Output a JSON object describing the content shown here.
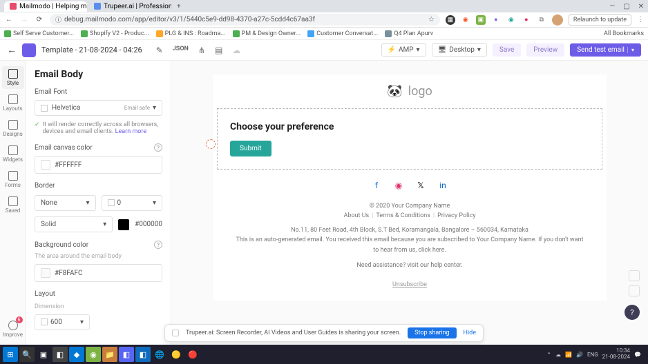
{
  "browser": {
    "tabs": [
      {
        "title": "Mailmodo | Helping marketer..."
      },
      {
        "title": "Trupeer.ai | Professional Vide..."
      }
    ],
    "url": "debug.mailmodo.com/app/editor/v3/1/5440c5e9-dd98-4370-a27c-5cdd4c67aa3f",
    "relaunch": "Relaunch to update",
    "all_bookmarks": "All Bookmarks",
    "bookmarks": [
      "Self Serve Customer...",
      "Shopify V2 - Produc...",
      "PLG & INS : Roadma...",
      "PM & Design Owner...",
      "Customer Conversat...",
      "Q4 Plan Apurv"
    ]
  },
  "header": {
    "title": "Template - 21-08-2024 - 04:26",
    "amp": "AMP",
    "desktop": "Desktop",
    "save": "Save",
    "preview": "Preview",
    "send": "Send test email"
  },
  "leftnav": [
    {
      "label": "Style"
    },
    {
      "label": "Layouts"
    },
    {
      "label": "Designs"
    },
    {
      "label": "Widgets"
    },
    {
      "label": "Forms"
    },
    {
      "label": "Saved"
    },
    {
      "label": "Improve",
      "badge": "6"
    }
  ],
  "sidebar": {
    "title": "Email Body",
    "font_label": "Email Font",
    "font_value": "Helvetica",
    "font_badge": "Email safe",
    "hint_text": "It will render correctly across all browsers, devices and email clients.",
    "hint_link": "Learn more",
    "canvas_color_label": "Email canvas color",
    "canvas_color_value": "#FFFFFF",
    "border_label": "Border",
    "border_style": "None",
    "border_width": "0",
    "border_line": "Solid",
    "border_color": "#000000",
    "bg_label": "Background color",
    "bg_sublabel": "The area around the email body",
    "bg_value": "#F8FAFC",
    "layout_label": "Layout",
    "dimension_label": "Dimension",
    "dimension_value": "600"
  },
  "email": {
    "logo_text": "logo",
    "preference_title": "Choose your preference",
    "submit": "Submit",
    "copyright": "© 2020 Your Company Name",
    "links": [
      "About Us",
      "Terms & Conditions",
      "Privacy Policy"
    ],
    "address": "No.11, 80 Feet Road, 4th Block, S.T Bed, Koramangala, Bangalore – 560034, Karnataka",
    "auto_gen": "This is an auto-generated email. You received this email because you are subscribed to Your Company Name. If you don't want to hear from us, click here.",
    "assistance": "Need assistance? visit our help center.",
    "unsubscribe": "Unsubscribe"
  },
  "share": {
    "message": "Trupeer.ai: Screen Recorder, AI Videos and User Guides is sharing your screen.",
    "stop": "Stop sharing",
    "hide": "Hide"
  },
  "tray": {
    "time": "10:34",
    "date": "21-08-2024"
  }
}
